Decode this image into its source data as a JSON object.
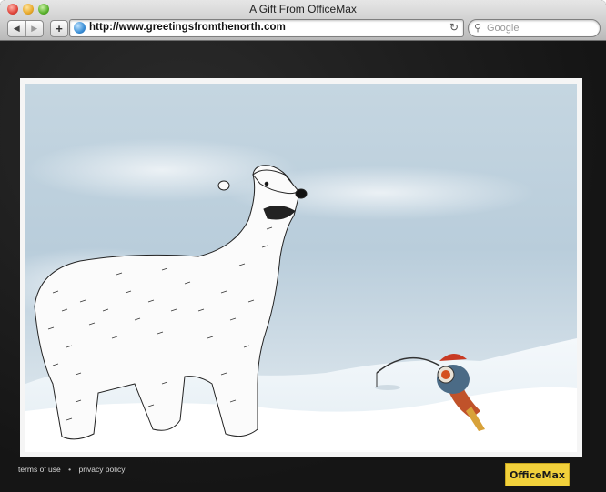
{
  "window": {
    "title": "A Gift From OfficeMax"
  },
  "toolbar": {
    "back_icon": "back-arrow-icon",
    "forward_icon": "forward-arrow-icon",
    "add_label": "+",
    "url": "http://www.greetingsfromthenorth.com",
    "reload_icon": "reload-icon",
    "search_placeholder": "Google"
  },
  "page": {
    "footer": {
      "terms": "terms of use",
      "separator": "•",
      "privacy": "privacy policy"
    },
    "brand": "OfficeMax",
    "colors": {
      "brand_yellow": "#f2d13b",
      "background": "#151515",
      "sky": "#bfd1de"
    }
  }
}
